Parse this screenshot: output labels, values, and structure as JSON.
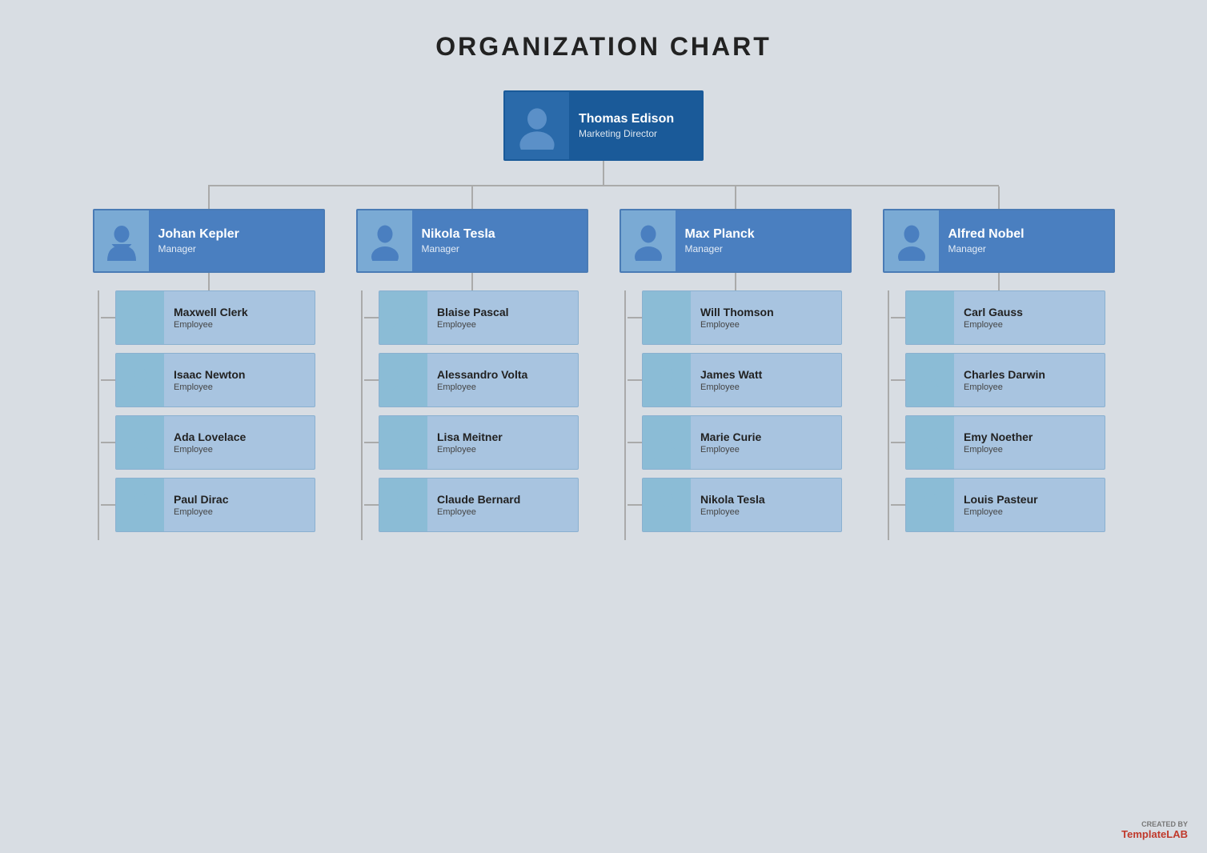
{
  "title": "ORGANIZATION CHART",
  "top": {
    "name": "Thomas Edison",
    "role": "Marketing Director"
  },
  "managers": [
    {
      "name": "Johan Kepler",
      "role": "Manager"
    },
    {
      "name": "Nikola Tesla",
      "role": "Manager"
    },
    {
      "name": "Max Planck",
      "role": "Manager"
    },
    {
      "name": "Alfred Nobel",
      "role": "Manager"
    }
  ],
  "employees": [
    [
      {
        "name": "Maxwell Clerk",
        "role": "Employee"
      },
      {
        "name": "Isaac Newton",
        "role": "Employee"
      },
      {
        "name": "Ada Lovelace",
        "role": "Employee"
      },
      {
        "name": "Paul Dirac",
        "role": "Employee"
      }
    ],
    [
      {
        "name": "Blaise Pascal",
        "role": "Employee"
      },
      {
        "name": "Alessandro Volta",
        "role": "Employee"
      },
      {
        "name": "Lisa Meitner",
        "role": "Employee"
      },
      {
        "name": "Claude Bernard",
        "role": "Employee"
      }
    ],
    [
      {
        "name": "Will Thomson",
        "role": "Employee"
      },
      {
        "name": "James Watt",
        "role": "Employee"
      },
      {
        "name": "Marie Curie",
        "role": "Employee"
      },
      {
        "name": "Nikola Tesla",
        "role": "Employee"
      }
    ],
    [
      {
        "name": "Carl Gauss",
        "role": "Employee"
      },
      {
        "name": "Charles Darwin",
        "role": "Employee"
      },
      {
        "name": "Emy Noether",
        "role": "Employee"
      },
      {
        "name": "Louis Pasteur",
        "role": "Employee"
      }
    ]
  ],
  "watermark": {
    "created_by": "CREATED BY",
    "brand_prefix": "Template",
    "brand_suffix": "LAB"
  },
  "colors": {
    "bg": "#d8dde3",
    "top_card_bg": "#1a5a99",
    "manager_card_bg": "#4a7fc0",
    "employee_card_bg": "#a8c4e0",
    "line_color": "#aaaaaa"
  },
  "avatar_types": {
    "male": "male",
    "female": "female"
  },
  "avatar_gender": [
    [
      "female",
      "male",
      "female",
      "male"
    ],
    [
      "male",
      "male",
      "female",
      "male"
    ],
    [
      "male",
      "male",
      "female",
      "male"
    ],
    [
      "male",
      "female",
      "female",
      "male"
    ]
  ],
  "manager_gender": [
    "female",
    "male",
    "male",
    "male"
  ],
  "top_gender": "male"
}
